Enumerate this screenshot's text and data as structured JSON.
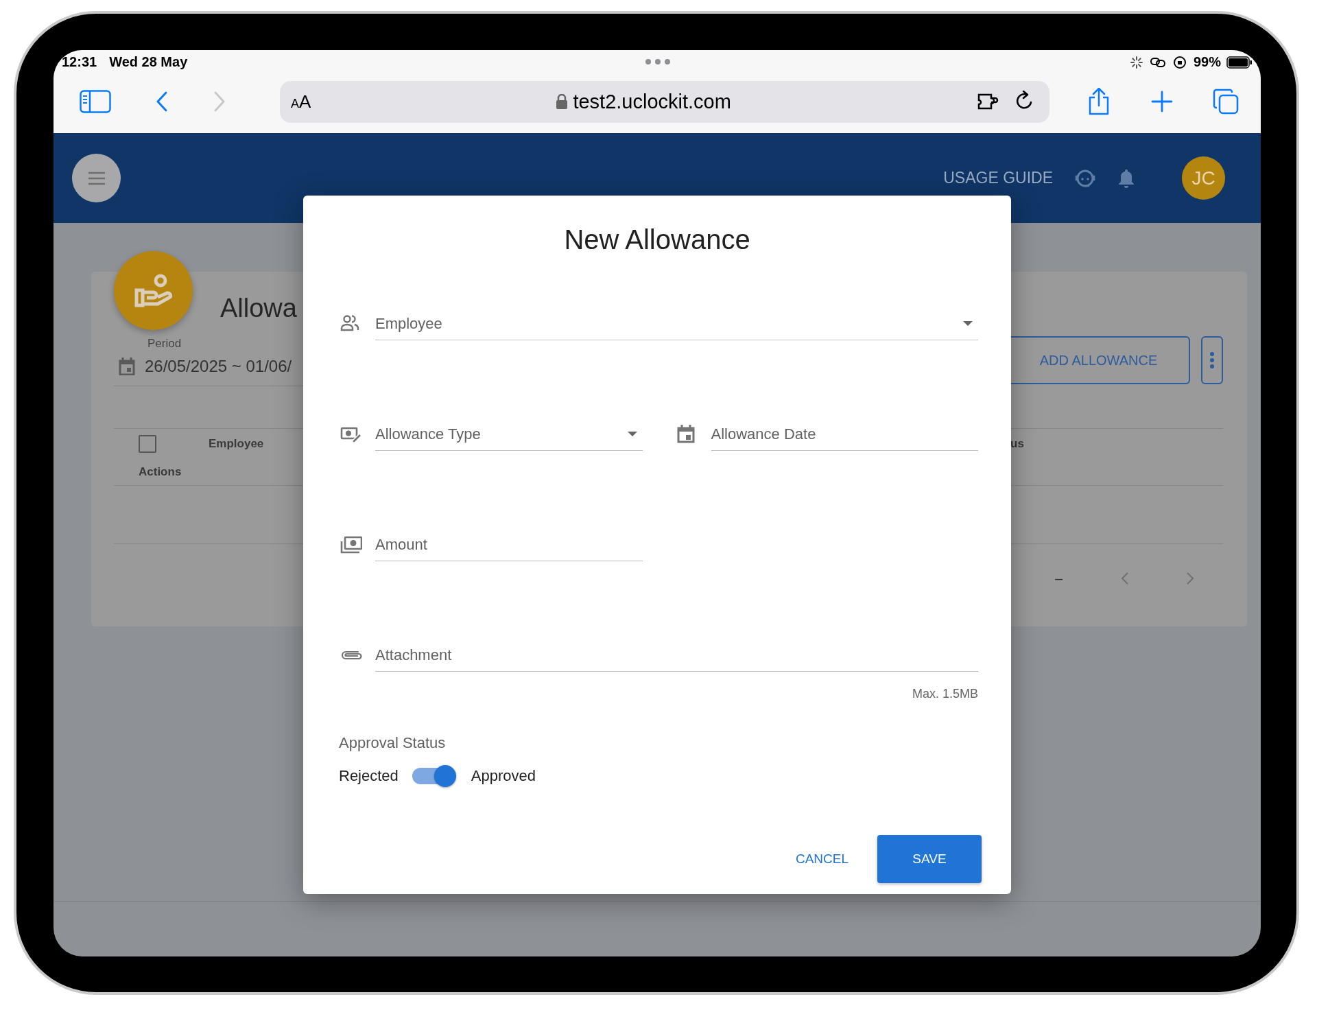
{
  "status_bar": {
    "time": "12:31",
    "date": "Wed 28 May",
    "battery": "99%"
  },
  "browser": {
    "text_size": "AA",
    "url": "test2.uclockit.com",
    "back_disabled": false,
    "forward_disabled": true
  },
  "app_header": {
    "usage_guide": "USAGE GUIDE",
    "avatar": "JC"
  },
  "page": {
    "title": "Allowa",
    "period_label": "Period",
    "period": "26/05/2025 ~ 01/06/",
    "add_button": "ADD ALLOWANCE",
    "table": {
      "select_all_checked": false,
      "columns": [
        {
          "label": "Employee"
        },
        {
          "label": "us"
        },
        {
          "label": "Actions"
        }
      ]
    },
    "pagination": {
      "range": "–"
    }
  },
  "dialog": {
    "title": "New Allowance",
    "rows": [
      {
        "fields": [
          {
            "kind": "person",
            "placeholder": "Employee",
            "wide": true
          }
        ]
      },
      {
        "fields": [
          {
            "kind": "category",
            "placeholder": "Allowance Type",
            "wide": false
          },
          {
            "kind": "date",
            "placeholder": "Allowance Date",
            "wide": false
          }
        ]
      },
      {
        "fields": [
          {
            "kind": "amount",
            "placeholder": "Amount",
            "wide": false
          }
        ]
      },
      {
        "fields": [
          {
            "kind": "file",
            "placeholder": "Attachment",
            "wide": true,
            "hint": "Max. 1.5MB"
          }
        ]
      }
    ],
    "approval": {
      "label": "Approval Status",
      "off_label": "Rejected",
      "on_label": "Approved",
      "on": true
    },
    "buttons": [
      {
        "label": "CANCEL",
        "kind": "text"
      },
      {
        "label": "SAVE",
        "kind": "primary"
      }
    ]
  }
}
